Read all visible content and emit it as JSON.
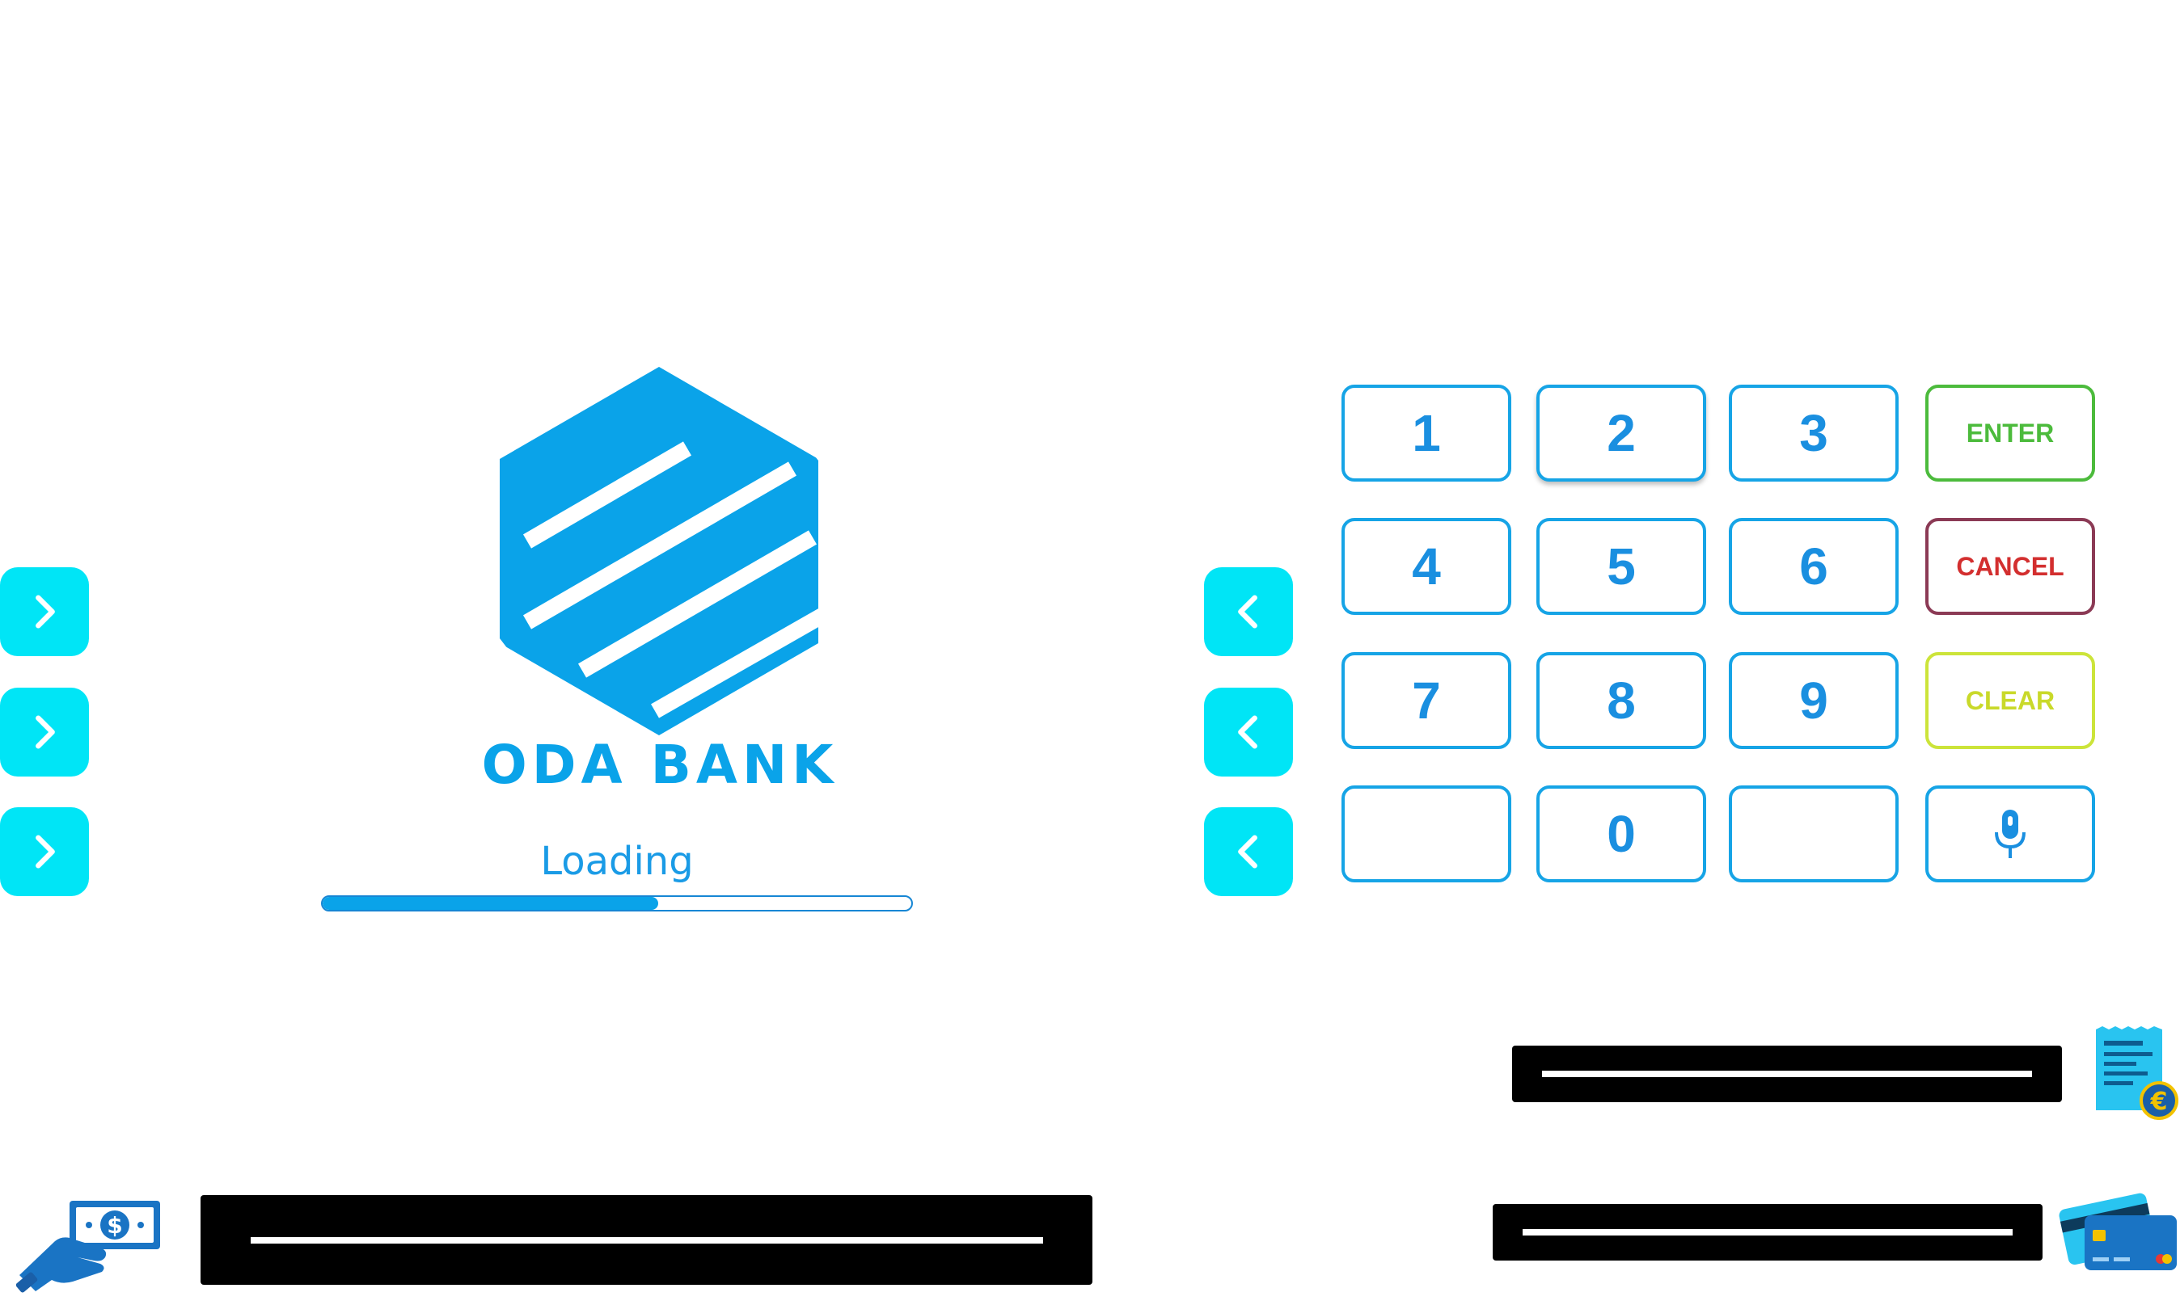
{
  "brand": {
    "name": "ODA BANK",
    "color": "#0aa3e9"
  },
  "loading": {
    "label": "Loading",
    "progress": 0.57
  },
  "side_buttons": {
    "left": [
      "chevron-right-icon",
      "chevron-right-icon",
      "chevron-right-icon"
    ],
    "right": [
      "chevron-left-icon",
      "chevron-left-icon",
      "chevron-left-icon"
    ],
    "color": "#00e5f6"
  },
  "keypad": {
    "digits": {
      "k1": "1",
      "k2": "2",
      "k3": "3",
      "k4": "4",
      "k5": "5",
      "k6": "6",
      "k7": "7",
      "k8": "8",
      "k9": "9",
      "k0": "0"
    },
    "enter": "ENTER",
    "cancel": "CANCEL",
    "clear": "CLEAR",
    "voice_icon": "microphone-icon",
    "colors": {
      "digit": "#1a8fe0",
      "enter": "#4cbb3c",
      "cancel": "#d32f2f",
      "clear": "#c9d92a"
    }
  },
  "slots": {
    "receipt_icon": "receipt-euro-icon",
    "card_icon": "credit-card-icon",
    "cash_icon": "cash-hand-icon"
  }
}
